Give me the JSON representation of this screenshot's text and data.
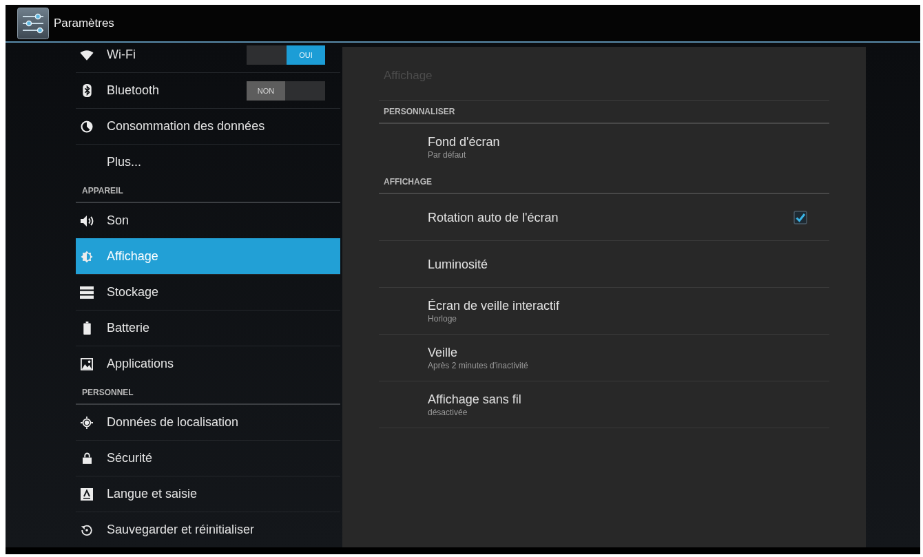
{
  "action_bar": {
    "title": "Paramètres"
  },
  "sidebar": {
    "groups": [
      {
        "items": [
          {
            "label": "Wi-Fi",
            "selected": false,
            "toggle": {
              "label": "OUI",
              "on": true
            }
          },
          {
            "label": "Bluetooth",
            "selected": false,
            "toggle": {
              "label": "NON",
              "on": false
            }
          },
          {
            "label": "Consommation des données",
            "selected": false
          },
          {
            "label": "Plus...",
            "selected": false
          }
        ]
      },
      {
        "header": "APPAREIL",
        "items": [
          {
            "label": "Son",
            "selected": false
          },
          {
            "label": "Affichage",
            "selected": true
          },
          {
            "label": "Stockage",
            "selected": false
          },
          {
            "label": "Batterie",
            "selected": false
          },
          {
            "label": "Applications",
            "selected": false
          }
        ]
      },
      {
        "header": "PERSONNEL",
        "items": [
          {
            "label": "Données de localisation",
            "selected": false
          },
          {
            "label": "Sécurité",
            "selected": false
          },
          {
            "label": "Langue et saisie",
            "selected": false
          },
          {
            "label": "Sauvegarder et réinitialiser",
            "selected": false
          }
        ]
      }
    ]
  },
  "detail": {
    "title": "Affichage",
    "sections": [
      {
        "header": "PERSONNALISER",
        "items": [
          {
            "kind": "plain",
            "title": "Fond d'écran",
            "summary": "Par défaut"
          }
        ]
      },
      {
        "header": "AFFICHAGE",
        "items": [
          {
            "kind": "checkbox",
            "title": "Rotation auto de l'écran",
            "checked": true
          },
          {
            "kind": "plain",
            "title": "Luminosité"
          },
          {
            "kind": "plain",
            "title": "Écran de veille interactif",
            "summary": "Horloge"
          },
          {
            "kind": "plain",
            "title": "Veille",
            "summary": "Après 2 minutes d'inactivité"
          },
          {
            "kind": "plain",
            "title": "Affichage sans fil",
            "summary": "désactivée"
          }
        ]
      }
    ]
  }
}
